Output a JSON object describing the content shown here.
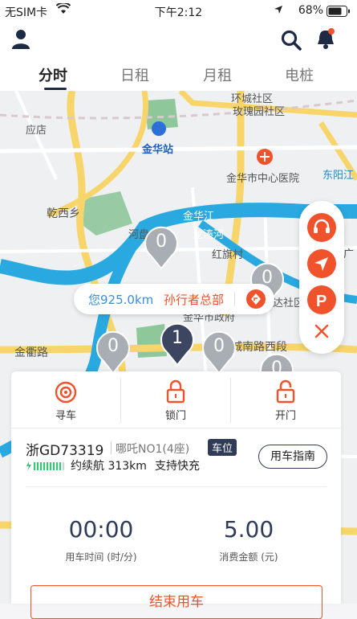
{
  "status_bar": {
    "carrier": "无SIM卡",
    "time": "下午2:12",
    "battery": "68%"
  },
  "header": {
    "user_icon": "person-icon",
    "search_icon": "search-icon",
    "bell_icon": "bell-icon",
    "tabs": [
      {
        "label": "分时",
        "active": true
      },
      {
        "label": "日租",
        "active": false
      },
      {
        "label": "月租",
        "active": false
      },
      {
        "label": "电桩",
        "active": false
      }
    ]
  },
  "map": {
    "labels": {
      "community1": "环城社区",
      "community2": "玫瑰园社区",
      "store": "应店",
      "station": "金华站",
      "hospital": "金华市中心医院",
      "east_yang": "东阳江",
      "qianxi": "乾西乡",
      "jinhua_river": "金华江",
      "river_port": "河盘",
      "longqin": "龙溱河",
      "hongshu": "红旗村",
      "city_gov": "金华市政府",
      "jinqu_road": "金衢路",
      "chengnan": "城南路西段",
      "dalian": "达社区",
      "guangchang": "广"
    },
    "pins": [
      {
        "value": "0",
        "selected": false
      },
      {
        "value": "0",
        "selected": false
      },
      {
        "value": "1",
        "selected": true
      },
      {
        "value": "0",
        "selected": false
      },
      {
        "value": "0",
        "selected": false
      },
      {
        "value": "0",
        "selected": false
      }
    ],
    "distance_bubble": {
      "distance": "您925.0km",
      "destination": "孙行者总部"
    }
  },
  "side_controls": [
    "support-icon",
    "locate-icon",
    "parking-icon",
    "close-icon"
  ],
  "car_panel": {
    "actions": [
      {
        "label": "寻车",
        "icon": "find-car-icon"
      },
      {
        "label": "锁门",
        "icon": "lock-icon"
      },
      {
        "label": "开门",
        "icon": "unlock-icon"
      }
    ],
    "plate": "浙GD73319",
    "model": "哪吒NO1(4座)",
    "badge": "车位",
    "guide_button": "用车指南",
    "range_text": "约续航 313km",
    "fast_charge": "支持快充",
    "battery_level": 0.9,
    "elapsed_time": "00:00",
    "elapsed_label": "用车时间 (时/分)",
    "amount": "5.00",
    "amount_label": "消费金额 (元)",
    "end_button": "结束用车"
  },
  "colors": {
    "accent": "#f0522c",
    "navy": "#1e2a44",
    "river": "#29a9e0",
    "road": "#f8d56a",
    "green": "#8ec79a"
  }
}
